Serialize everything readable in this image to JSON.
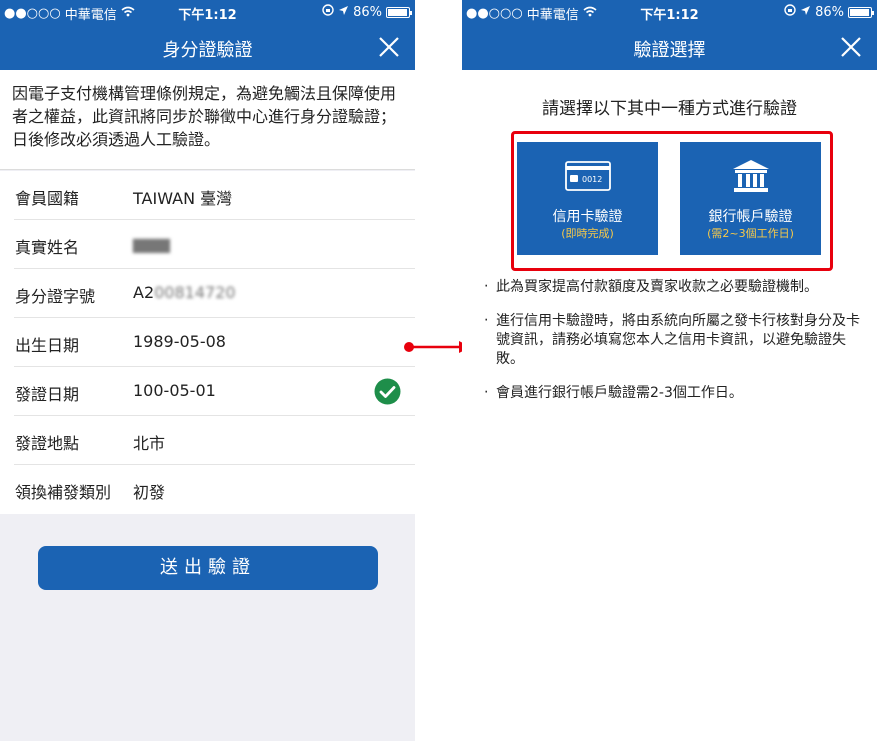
{
  "status_bar": {
    "carrier": "中華電信",
    "time": "下午1:12",
    "battery": "86%"
  },
  "left": {
    "title": "身分證驗證",
    "notice": "因電子支付機構管理條例規定，為避免觸法且保障使用者之權益，此資訊將同步於聯徵中心進行身分證驗證；日後修改必須透過人工驗證。",
    "rows": [
      {
        "label": "會員國籍",
        "value": "TAIWAN 臺灣"
      },
      {
        "label": "真實姓名",
        "value": "▆▆▆"
      },
      {
        "label": "身分證字號",
        "value": "A2",
        "masked": "00814720"
      },
      {
        "label": "出生日期",
        "value": "1989-05-08"
      },
      {
        "label": "發證日期",
        "value": "100-05-01"
      },
      {
        "label": "發證地點",
        "value": "北市"
      },
      {
        "label": "領換補發類別",
        "value": "初發"
      }
    ],
    "submit_label": "送出驗證"
  },
  "right": {
    "title": "驗證選擇",
    "heading": "請選擇以下其中一種方式進行驗證",
    "credit_card": {
      "title": "信用卡驗證",
      "sub": "(即時完成)",
      "card_text": "0012"
    },
    "bank": {
      "title": "銀行帳戶驗證",
      "sub": "(需2~3個工作日)"
    },
    "bullet": "‧",
    "notes": [
      "此為買家提高付款額度及賣家收款之必要驗證機制。",
      "進行信用卡驗證時，將由系統向所屬之發卡行核對身分及卡號資訊，請務必填寫您本人之信用卡資訊，以避免驗證失敗。",
      "會員進行銀行帳戶驗證需2-3個工作日。"
    ]
  },
  "colors": {
    "brand_blue": "#1b63b3",
    "highlight_red": "#e8000d",
    "check_green": "#1e8e4a",
    "subtext_yellow": "#f6c94a"
  }
}
